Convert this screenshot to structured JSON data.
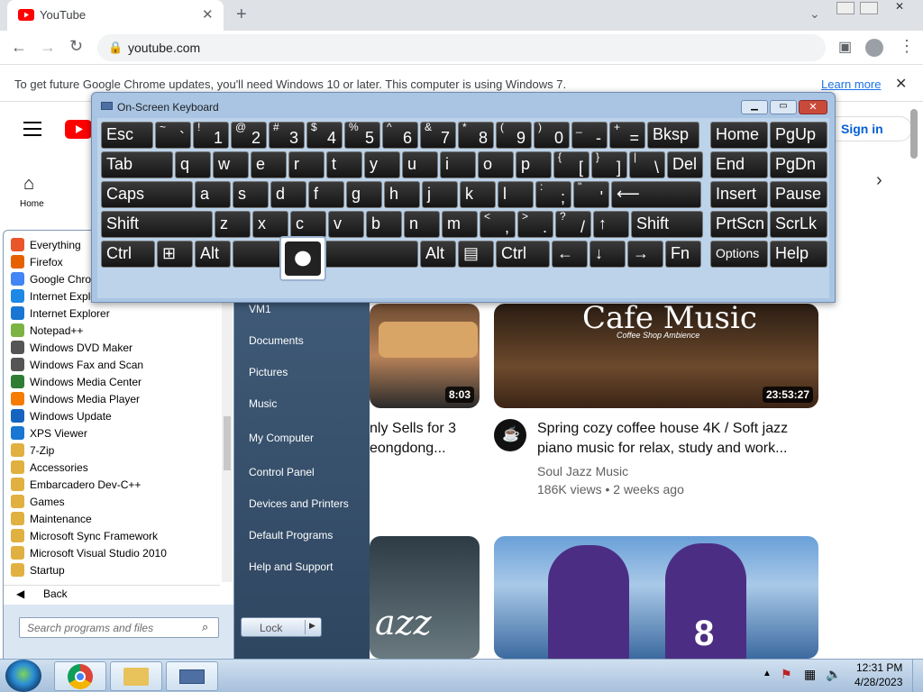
{
  "browser": {
    "tab_title": "YouTube",
    "url": "youtube.com",
    "infobar_message": "To get future Google Chrome updates, you'll need Windows 10 or later. This computer is using Windows 7.",
    "infobar_link": "Learn more"
  },
  "youtube": {
    "sign_in": "Sign in",
    "home_label": "Home",
    "videos": [
      {
        "title_line1": "nly Sells for 3",
        "title_line2": "eongdong...",
        "duration": "8:03"
      },
      {
        "title_line1": "Spring cozy coffee house 4K / Soft jazz",
        "title_line2": "piano music for relax, study and work...",
        "channel": "Soul Jazz Music",
        "meta": "186K views • 2 weeks ago",
        "duration": "23:53:27",
        "thumb_text": "Cafe Music",
        "thumb_sub": "Coffee Shop Ambience"
      },
      {
        "thumb_text": "azz"
      },
      {
        "thumb_number": "8"
      }
    ]
  },
  "osk": {
    "title": "On-Screen Keyboard",
    "rows": [
      [
        [
          "Esc",
          ""
        ],
        [
          "`",
          "~"
        ],
        [
          "1",
          "!"
        ],
        [
          "2",
          "@"
        ],
        [
          "3",
          "#"
        ],
        [
          "4",
          "$"
        ],
        [
          "5",
          "%"
        ],
        [
          "6",
          "^"
        ],
        [
          "7",
          "&"
        ],
        [
          "8",
          "*"
        ],
        [
          "9",
          "("
        ],
        [
          "0",
          ")"
        ],
        [
          "-",
          "_"
        ],
        [
          "=",
          "+"
        ],
        [
          "Bksp",
          ""
        ],
        [
          "Home",
          ""
        ],
        [
          "PgUp",
          ""
        ]
      ],
      [
        [
          "Tab",
          ""
        ],
        [
          "q",
          ""
        ],
        [
          "w",
          ""
        ],
        [
          "e",
          ""
        ],
        [
          "r",
          ""
        ],
        [
          "t",
          ""
        ],
        [
          "y",
          ""
        ],
        [
          "u",
          ""
        ],
        [
          "i",
          ""
        ],
        [
          "o",
          ""
        ],
        [
          "p",
          ""
        ],
        [
          "[",
          "{"
        ],
        [
          "]",
          "}"
        ],
        [
          "\\",
          "|"
        ],
        [
          "Del",
          ""
        ],
        [
          "End",
          ""
        ],
        [
          "PgDn",
          ""
        ]
      ],
      [
        [
          "Caps",
          ""
        ],
        [
          "a",
          ""
        ],
        [
          "s",
          ""
        ],
        [
          "d",
          ""
        ],
        [
          "f",
          ""
        ],
        [
          "g",
          ""
        ],
        [
          "h",
          ""
        ],
        [
          "j",
          ""
        ],
        [
          "k",
          ""
        ],
        [
          "l",
          ""
        ],
        [
          ";",
          ":"
        ],
        [
          "'",
          "\""
        ],
        [
          "⟵",
          ""
        ],
        [
          "Insert",
          ""
        ],
        [
          "Pause",
          ""
        ]
      ],
      [
        [
          "Shift",
          ""
        ],
        [
          "z",
          ""
        ],
        [
          "x",
          ""
        ],
        [
          "c",
          ""
        ],
        [
          "v",
          ""
        ],
        [
          "b",
          ""
        ],
        [
          "n",
          ""
        ],
        [
          "m",
          ""
        ],
        [
          ",",
          "<"
        ],
        [
          ".",
          ">"
        ],
        [
          "/",
          "?"
        ],
        [
          "↑",
          ""
        ],
        [
          "Shift",
          ""
        ],
        [
          "PrtScn",
          ""
        ],
        [
          "ScrLk",
          ""
        ]
      ],
      [
        [
          "Ctrl",
          ""
        ],
        [
          "⊞",
          ""
        ],
        [
          "Alt",
          ""
        ],
        [
          "",
          ""
        ],
        [
          "Alt",
          ""
        ],
        [
          "▤",
          ""
        ],
        [
          "Ctrl",
          ""
        ],
        [
          "←",
          ""
        ],
        [
          "↓",
          ""
        ],
        [
          "→",
          ""
        ],
        [
          "Fn",
          ""
        ],
        [
          "Options",
          ""
        ],
        [
          "Help",
          ""
        ]
      ]
    ]
  },
  "startmenu": {
    "programs": [
      "Everything",
      "Firefox",
      "Google Chro",
      "Internet Explo",
      "Internet Explorer",
      "Notepad++",
      "Windows DVD Maker",
      "Windows Fax and Scan",
      "Windows Media Center",
      "Windows Media Player",
      "Windows Update",
      "XPS Viewer",
      "7-Zip",
      "Accessories",
      "Embarcadero Dev-C++",
      "Games",
      "Maintenance",
      "Microsoft Sync Framework",
      "Microsoft Visual Studio 2010",
      "Startup"
    ],
    "program_colors": [
      "#e8562a",
      "#e66000",
      "#4285f4",
      "#1e88e5",
      "#1976d2",
      "#7cb342",
      "#555",
      "#555",
      "#2e7d32",
      "#f57c00",
      "#1565c0",
      "#1976d2",
      "#e0b040",
      "#e0b040",
      "#e0b040",
      "#e0b040",
      "#e0b040",
      "#e0b040",
      "#e0b040",
      "#e0b040"
    ],
    "back": "Back",
    "search_placeholder": "Search programs and files",
    "right_items": [
      "VM1",
      "Documents",
      "Pictures",
      "Music",
      "My Computer",
      "Control Panel",
      "Devices and Printers",
      "Default Programs",
      "Help and Support"
    ],
    "lock": "Lock"
  },
  "taskbar": {
    "time": "12:31 PM",
    "date": "4/28/2023"
  }
}
